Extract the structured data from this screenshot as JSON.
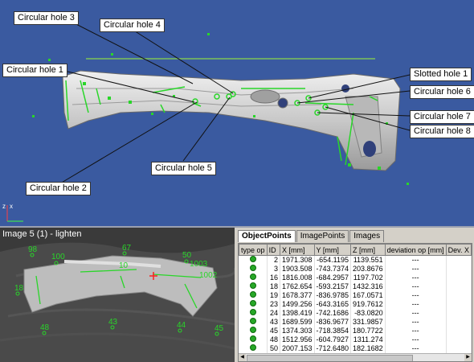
{
  "viewer": {
    "callouts": [
      {
        "id": "ch3",
        "label": "Circular hole 3"
      },
      {
        "id": "ch4",
        "label": "Circular hole 4"
      },
      {
        "id": "ch1",
        "label": "Circular hole 1"
      },
      {
        "id": "sh1",
        "label": "Slotted hole 1"
      },
      {
        "id": "ch6",
        "label": "Circular hole 6"
      },
      {
        "id": "ch7",
        "label": "Circular hole 7"
      },
      {
        "id": "ch8",
        "label": "Circular hole 8"
      },
      {
        "id": "ch5",
        "label": "Circular hole 5"
      },
      {
        "id": "ch2",
        "label": "Circular hole 2"
      }
    ],
    "axis_z": "z",
    "axis_x": "x"
  },
  "image_panel": {
    "title": "Image 5 (1) - lighten",
    "point_labels": [
      "98",
      "100",
      "67",
      "50",
      "1003",
      "1002",
      "10",
      "18",
      "48",
      "43",
      "44",
      "45"
    ]
  },
  "table_panel": {
    "tabs": [
      "ObjectPoints",
      "ImagePoints",
      "Images"
    ],
    "active_tab": "ObjectPoints",
    "columns": [
      "type op",
      "ID",
      "X [mm]",
      "Y [mm]",
      "Z [mm]",
      "deviation op [mm]",
      "Dev. X"
    ],
    "rows": [
      {
        "id": "2",
        "x": "1971.308",
        "y": "-654.1195",
        "z": "1139.551",
        "dev": "---"
      },
      {
        "id": "3",
        "x": "1903.508",
        "y": "-743.7374",
        "z": "203.8676",
        "dev": "---"
      },
      {
        "id": "16",
        "x": "1816.008",
        "y": "-684.2957",
        "z": "1197.702",
        "dev": "---"
      },
      {
        "id": "18",
        "x": "1762.654",
        "y": "-593.2157",
        "z": "1432.316",
        "dev": "---"
      },
      {
        "id": "19",
        "x": "1678.377",
        "y": "-836.9785",
        "z": "167.0571",
        "dev": "---"
      },
      {
        "id": "23",
        "x": "1499.256",
        "y": "-643.3165",
        "z": "919.7612",
        "dev": "---"
      },
      {
        "id": "24",
        "x": "1398.419",
        "y": "-742.1686",
        "z": "-83.0820",
        "dev": "---"
      },
      {
        "id": "43",
        "x": "1689.599",
        "y": "-836.9677",
        "z": "331.9857",
        "dev": "---"
      },
      {
        "id": "45",
        "x": "1374.303",
        "y": "-718.3854",
        "z": "180.7722",
        "dev": "---"
      },
      {
        "id": "48",
        "x": "1512.956",
        "y": "-604.7927",
        "z": "1311.274",
        "dev": "---"
      },
      {
        "id": "50",
        "x": "2007.153",
        "y": "-712.6480",
        "z": "182.1682",
        "dev": "---"
      }
    ]
  },
  "colors": {
    "viewer_bg": "#3a5aa0",
    "marker": "#29d629",
    "panel_bg": "#d4d0c8"
  }
}
